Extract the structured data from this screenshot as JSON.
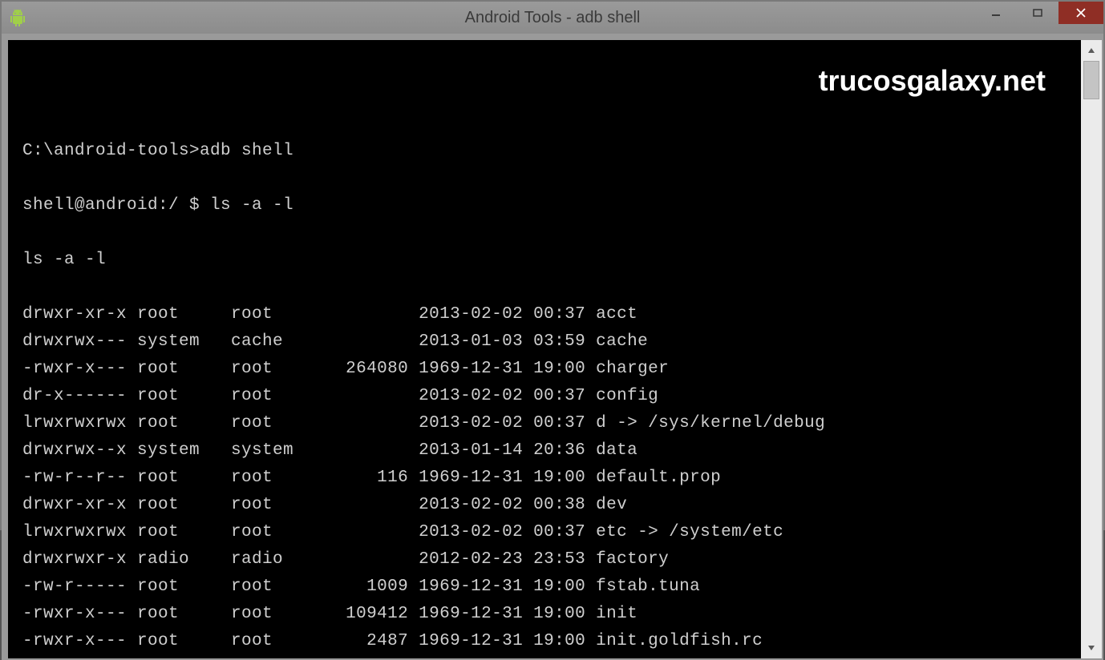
{
  "window": {
    "title": "Android Tools - adb  shell"
  },
  "watermark": "trucosgalaxy.net",
  "terminal": {
    "prompt1": "C:\\android-tools>adb shell",
    "prompt2": "shell@android:/ $ ls -a -l",
    "echo": "ls -a -l"
  },
  "listing": [
    {
      "perms": "drwxr-xr-x",
      "owner": "root",
      "group": "root",
      "size": "",
      "date": "2013-02-02 00:37",
      "name": "acct"
    },
    {
      "perms": "drwxrwx---",
      "owner": "system",
      "group": "cache",
      "size": "",
      "date": "2013-01-03 03:59",
      "name": "cache"
    },
    {
      "perms": "-rwxr-x---",
      "owner": "root",
      "group": "root",
      "size": "264080",
      "date": "1969-12-31 19:00",
      "name": "charger"
    },
    {
      "perms": "dr-x------",
      "owner": "root",
      "group": "root",
      "size": "",
      "date": "2013-02-02 00:37",
      "name": "config"
    },
    {
      "perms": "lrwxrwxrwx",
      "owner": "root",
      "group": "root",
      "size": "",
      "date": "2013-02-02 00:37",
      "name": "d -> /sys/kernel/debug"
    },
    {
      "perms": "drwxrwx--x",
      "owner": "system",
      "group": "system",
      "size": "",
      "date": "2013-01-14 20:36",
      "name": "data"
    },
    {
      "perms": "-rw-r--r--",
      "owner": "root",
      "group": "root",
      "size": "116",
      "date": "1969-12-31 19:00",
      "name": "default.prop"
    },
    {
      "perms": "drwxr-xr-x",
      "owner": "root",
      "group": "root",
      "size": "",
      "date": "2013-02-02 00:38",
      "name": "dev"
    },
    {
      "perms": "lrwxrwxrwx",
      "owner": "root",
      "group": "root",
      "size": "",
      "date": "2013-02-02 00:37",
      "name": "etc -> /system/etc"
    },
    {
      "perms": "drwxrwxr-x",
      "owner": "radio",
      "group": "radio",
      "size": "",
      "date": "2012-02-23 23:53",
      "name": "factory"
    },
    {
      "perms": "-rw-r-----",
      "owner": "root",
      "group": "root",
      "size": "1009",
      "date": "1969-12-31 19:00",
      "name": "fstab.tuna"
    },
    {
      "perms": "-rwxr-x---",
      "owner": "root",
      "group": "root",
      "size": "109412",
      "date": "1969-12-31 19:00",
      "name": "init"
    },
    {
      "perms": "-rwxr-x---",
      "owner": "root",
      "group": "root",
      "size": "2487",
      "date": "1969-12-31 19:00",
      "name": "init.goldfish.rc"
    }
  ]
}
